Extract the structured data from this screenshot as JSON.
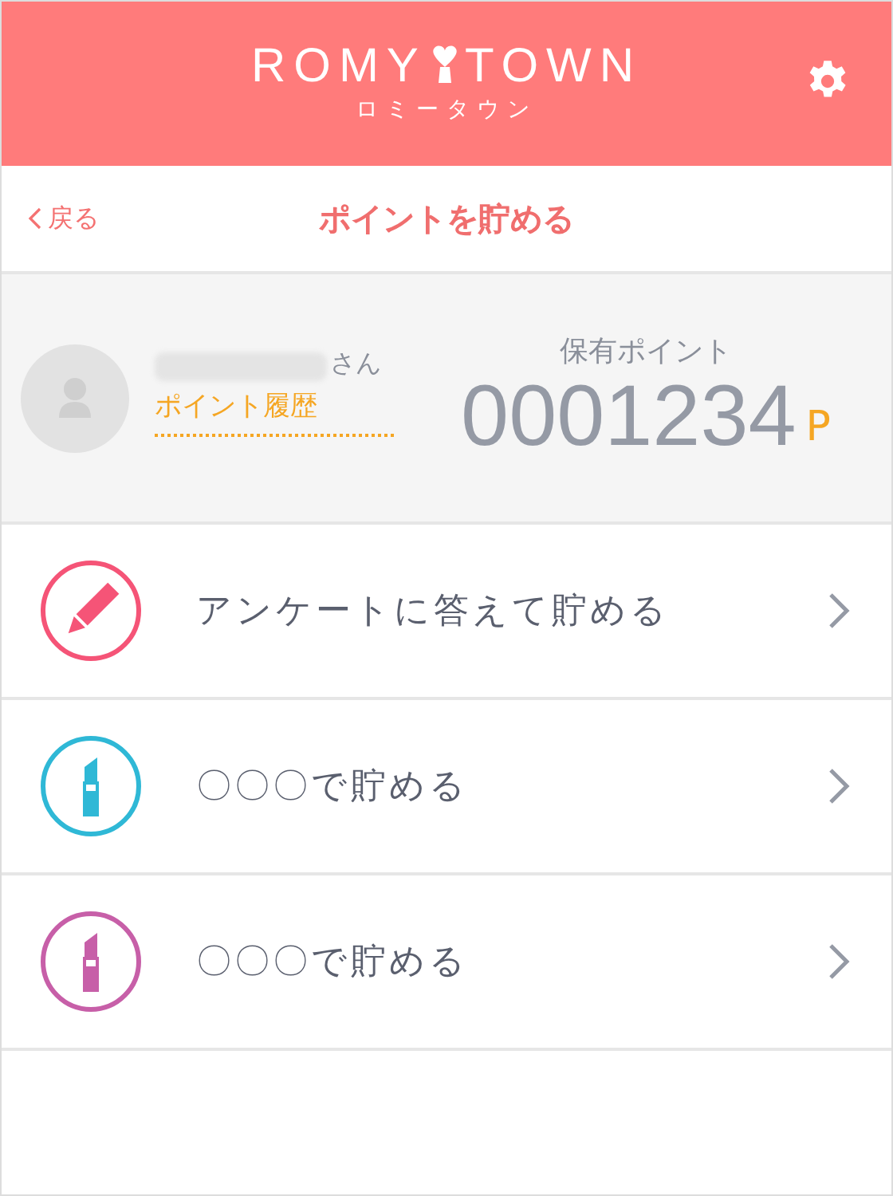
{
  "header": {
    "logo_left": "ROMY",
    "logo_right": "TOWN",
    "logo_kana": "ロミータウン"
  },
  "nav": {
    "back": "戻る",
    "title": "ポイントを貯める"
  },
  "profile": {
    "honorific": "さん",
    "history_link": "ポイント履歴",
    "points_label": "保有ポイント",
    "points": "0001234",
    "unit": "P"
  },
  "items": [
    {
      "kind": "pencil",
      "color": "#f55477",
      "label": "アンケートに答えて貯める"
    },
    {
      "kind": "lipstick",
      "color": "#2fb8d6",
      "label": "〇〇〇で貯める"
    },
    {
      "kind": "lipstick",
      "color": "#c75fa8",
      "label": "〇〇〇で貯める"
    }
  ]
}
